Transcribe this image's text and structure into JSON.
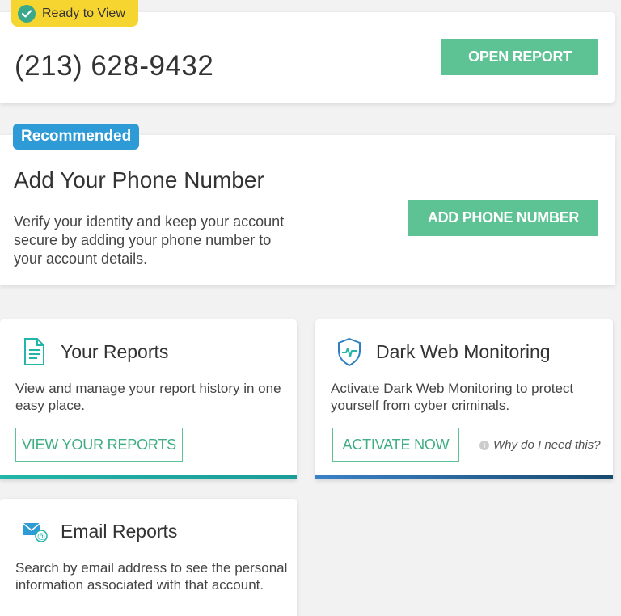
{
  "ready_card": {
    "badge": "Ready to View",
    "phone": "(213) 628-9432",
    "button": "OPEN REPORT"
  },
  "phone_card": {
    "badge": "Recommended",
    "title": "Add Your Phone Number",
    "description": "Verify your identity and keep your account secure by adding your phone number to your account details.",
    "button": "ADD PHONE NUMBER"
  },
  "reports_card": {
    "title": "Your Reports",
    "text": "View and manage your report history in one easy place.",
    "button": "VIEW YOUR REPORTS",
    "icon": "document-icon"
  },
  "dark_web_card": {
    "title": "Dark Web Monitoring",
    "text": "Activate Dark Web Monitoring to protect yourself from cyber criminals.",
    "button": "ACTIVATE NOW",
    "why": "Why do I need this?",
    "icon": "shield-pulse-icon"
  },
  "email_card": {
    "title": "Email Reports",
    "text": "Search by email address to see the personal information associated with that account.",
    "icon": "email-icon"
  },
  "colors": {
    "green": "#5ec394",
    "yellow": "#f7d531",
    "blue": "#2e9bd6",
    "teal_bar": "#1a9c98",
    "navy_bar": "#174a6e"
  }
}
